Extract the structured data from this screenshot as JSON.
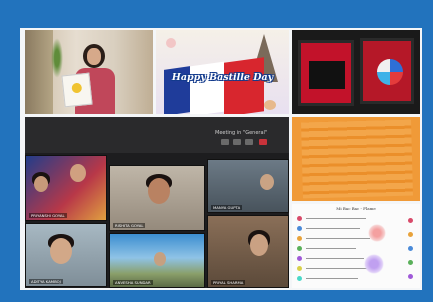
{
  "collage": {
    "bastille_title": "Happy Bastille Day",
    "meeting_title": "Meeting in \"General\"",
    "participants": [
      "PRIYANSHI GOYAL",
      "RISHITA GOYAL",
      "MANYA GUPTA",
      "ADITYA KAMBOJ",
      "ANVESHA SUNDAR",
      "PRIYAL SHARMA"
    ],
    "worksheet_heading": "Mi Bac Bac - Flame"
  },
  "colors": {
    "frame": "#2273bd",
    "flag_blue": "#1f3c9a",
    "flag_red": "#d8262e",
    "braille_orange": "#f09a38"
  }
}
